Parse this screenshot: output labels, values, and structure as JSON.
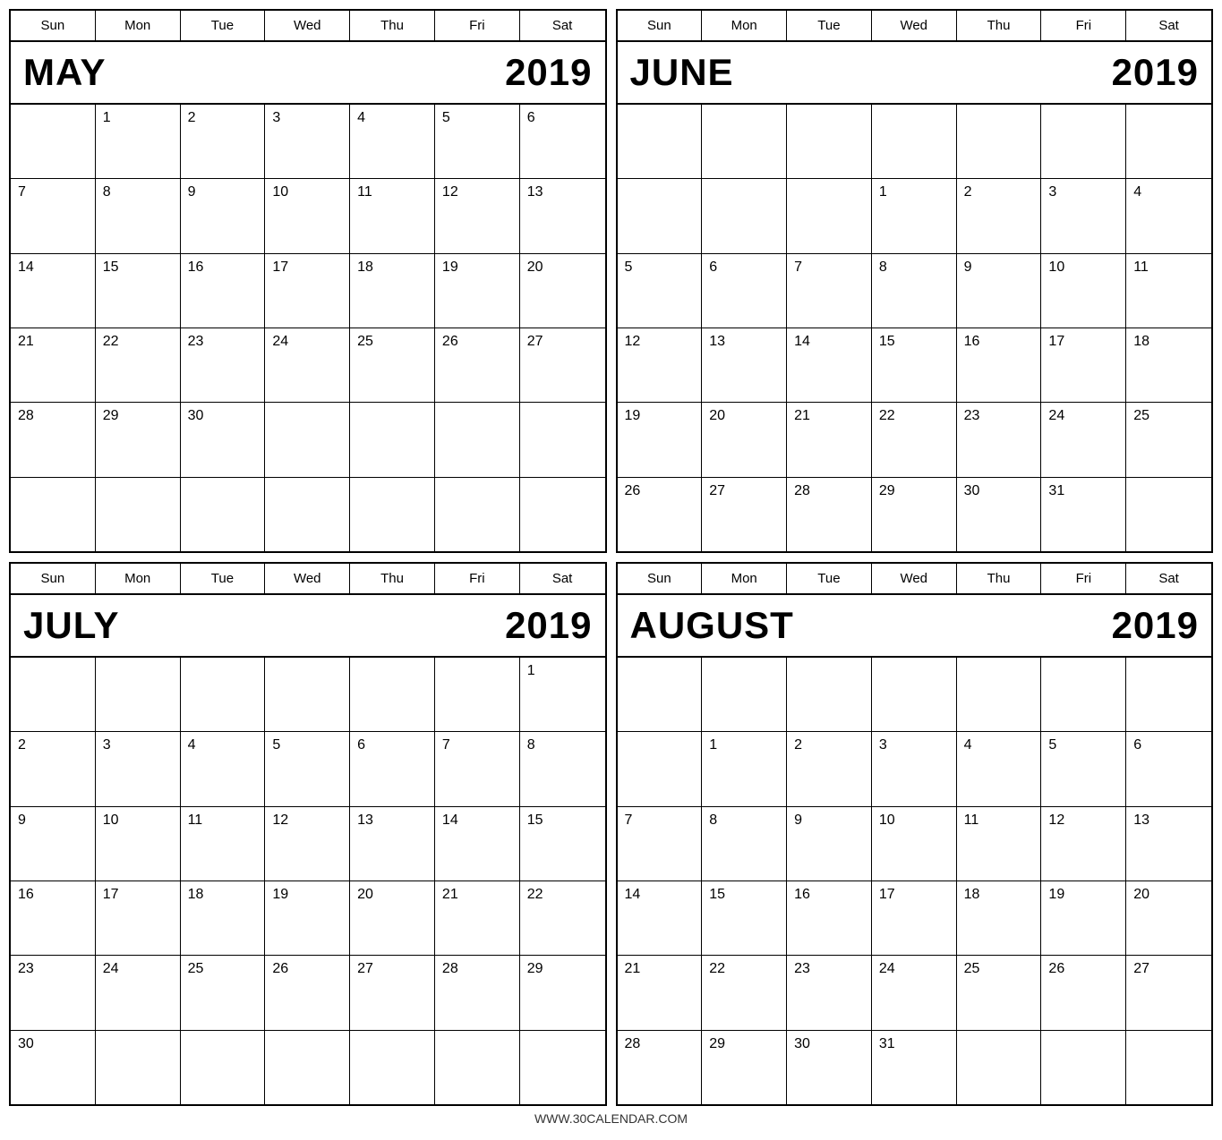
{
  "footer": {
    "url": "WWW.30CALENDAR.COM"
  },
  "days_of_week": [
    "Sun",
    "Mon",
    "Tue",
    "Wed",
    "Thu",
    "Fri",
    "Sat"
  ],
  "calendars": [
    {
      "id": "may-2019",
      "month": "MAY",
      "year": "2019",
      "weeks": [
        [
          "",
          "1",
          "2",
          "3",
          "4",
          "5",
          "6"
        ],
        [
          "7",
          "8",
          "9",
          "10",
          "11",
          "12",
          "13"
        ],
        [
          "14",
          "15",
          "16",
          "17",
          "18",
          "19",
          "20"
        ],
        [
          "21",
          "22",
          "23",
          "24",
          "25",
          "26",
          "27"
        ],
        [
          "28",
          "29",
          "30",
          "",
          "",
          "",
          ""
        ],
        [
          "",
          "",
          "",
          "",
          "",
          "",
          ""
        ]
      ]
    },
    {
      "id": "june-2019",
      "month": "JUNE",
      "year": "2019",
      "weeks": [
        [
          "",
          "",
          "",
          "",
          "",
          "",
          ""
        ],
        [
          "",
          "",
          "",
          "",
          "1",
          "2",
          "3",
          "4"
        ],
        [
          "5",
          "6",
          "7",
          "8",
          "9",
          "10",
          "11"
        ],
        [
          "12",
          "13",
          "14",
          "15",
          "16",
          "17",
          "18"
        ],
        [
          "19",
          "20",
          "21",
          "22",
          "23",
          "24",
          "25"
        ],
        [
          "26",
          "27",
          "28",
          "29",
          "30",
          "31",
          ""
        ]
      ]
    },
    {
      "id": "july-2019",
      "month": "JULY",
      "year": "2019",
      "weeks": [
        [
          "",
          "",
          "",
          "",
          "",
          "",
          "1"
        ],
        [
          "2",
          "3",
          "4",
          "5",
          "6",
          "7",
          "8"
        ],
        [
          "9",
          "10",
          "11",
          "12",
          "13",
          "14",
          "15"
        ],
        [
          "16",
          "17",
          "18",
          "19",
          "20",
          "21",
          "22"
        ],
        [
          "23",
          "24",
          "25",
          "26",
          "27",
          "28",
          "29"
        ],
        [
          "30",
          "",
          "",
          "",
          "",
          "",
          ""
        ]
      ]
    },
    {
      "id": "august-2019",
      "month": "AUGUST",
      "year": "2019",
      "weeks": [
        [
          "",
          "",
          "",
          "",
          "",
          "",
          ""
        ],
        [
          "",
          "1",
          "2",
          "3",
          "4",
          "5",
          "6"
        ],
        [
          "7",
          "8",
          "9",
          "10",
          "11",
          "12",
          "13"
        ],
        [
          "14",
          "15",
          "16",
          "17",
          "18",
          "19",
          "20"
        ],
        [
          "21",
          "22",
          "23",
          "24",
          "25",
          "26",
          "27"
        ],
        [
          "28",
          "29",
          "30",
          "31",
          "",
          "",
          ""
        ]
      ]
    }
  ]
}
